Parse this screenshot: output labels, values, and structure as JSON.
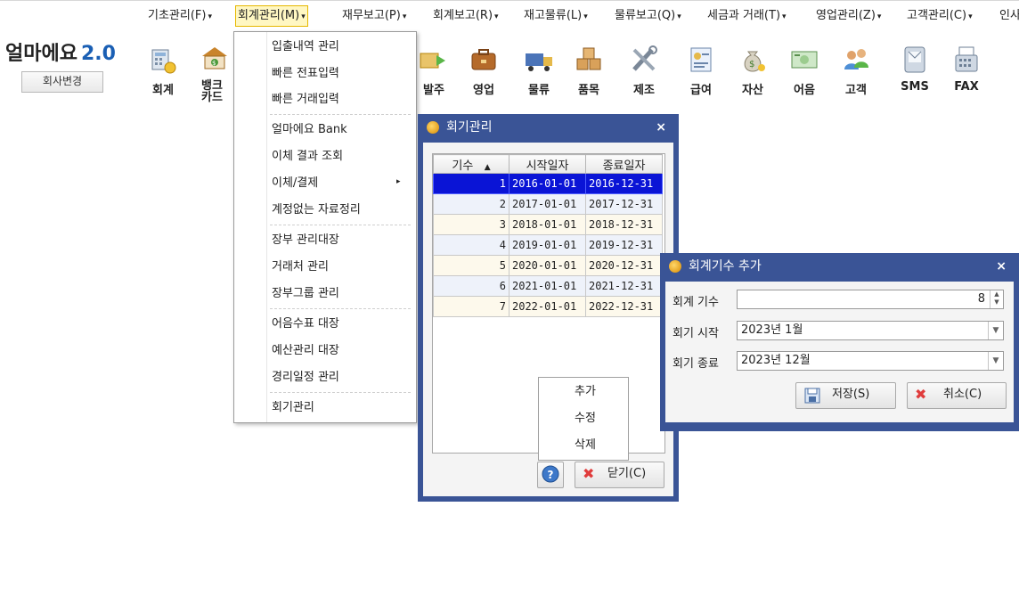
{
  "menu": {
    "items": [
      "기초관리(F)",
      "회계관리(M)",
      "재무보고(P)",
      "회계보고(R)",
      "재고물류(L)",
      "물류보고(Q)",
      "세금과 거래(T)",
      "영업관리(Z)",
      "고객관리(C)",
      "인사"
    ],
    "active_index": 1
  },
  "brand": {
    "name": "얼마에요",
    "version": "2.0",
    "company_button": "회사변경"
  },
  "toolbar": {
    "items": [
      {
        "label": "회계",
        "icon": "calculator-coins-icon"
      },
      {
        "label": "뱅크\n카드",
        "icon": "bank-icon"
      },
      {
        "label": "발주",
        "icon": "order-truck-icon"
      },
      {
        "label": "영업",
        "icon": "briefcase-icon"
      },
      {
        "label": "물류",
        "icon": "delivery-truck-icon"
      },
      {
        "label": "품목",
        "icon": "boxes-icon"
      },
      {
        "label": "제조",
        "icon": "tools-icon"
      },
      {
        "label": "급여",
        "icon": "payroll-icon"
      },
      {
        "label": "자산",
        "icon": "money-bag-icon"
      },
      {
        "label": "어음",
        "icon": "banknote-icon"
      },
      {
        "label": "고객",
        "icon": "people-icon"
      },
      {
        "label": "SMS",
        "icon": "phone-icon"
      },
      {
        "label": "FAX",
        "icon": "fax-icon"
      }
    ]
  },
  "dropdown": {
    "items": [
      "입출내역 관리",
      "빠른 전표입력",
      "빠른 거래입력",
      "얼마에요 Bank",
      "이체 결과 조회",
      "이체/결제",
      "계정없는 자료정리",
      "장부 관리대장",
      "거래처 관리",
      "장부그룹 관리",
      "어음수표 대장",
      "예산관리 대장",
      "경리일정 관리",
      "회기관리"
    ],
    "submenu_arrow": "▸"
  },
  "fiscal_dialog": {
    "title": "회기관리",
    "close_glyph": "×",
    "columns": [
      "기수",
      "시작일자",
      "종료일자"
    ],
    "sort_glyph": "▲",
    "rows": [
      {
        "term": "1",
        "start": "2016-01-01",
        "end": "2016-12-31"
      },
      {
        "term": "2",
        "start": "2017-01-01",
        "end": "2017-12-31"
      },
      {
        "term": "3",
        "start": "2018-01-01",
        "end": "2018-12-31"
      },
      {
        "term": "4",
        "start": "2019-01-01",
        "end": "2019-12-31"
      },
      {
        "term": "5",
        "start": "2020-01-01",
        "end": "2020-12-31"
      },
      {
        "term": "6",
        "start": "2021-01-01",
        "end": "2021-12-31"
      },
      {
        "term": "7",
        "start": "2022-01-01",
        "end": "2022-12-31"
      }
    ],
    "selected_row": 0,
    "context_menu": [
      "추가",
      "수정",
      "삭제"
    ],
    "close_button": "닫기(C)"
  },
  "add_term_dialog": {
    "title": "회계기수 추가",
    "close_glyph": "×",
    "fields": {
      "term_label": "회계 기수",
      "term_value": "8",
      "start_label": "회기 시작",
      "start_value": "2023년 1월",
      "end_label": "회기 종료",
      "end_value": "2023년 12월"
    },
    "save_button": "저장(S)",
    "cancel_button": "취소(C)"
  },
  "colors": {
    "dialog_frame": "#3a5496",
    "selection": "#0a14d6",
    "menu_highlight": "#fff7c2",
    "brand_accent": "#1a5fb4"
  }
}
